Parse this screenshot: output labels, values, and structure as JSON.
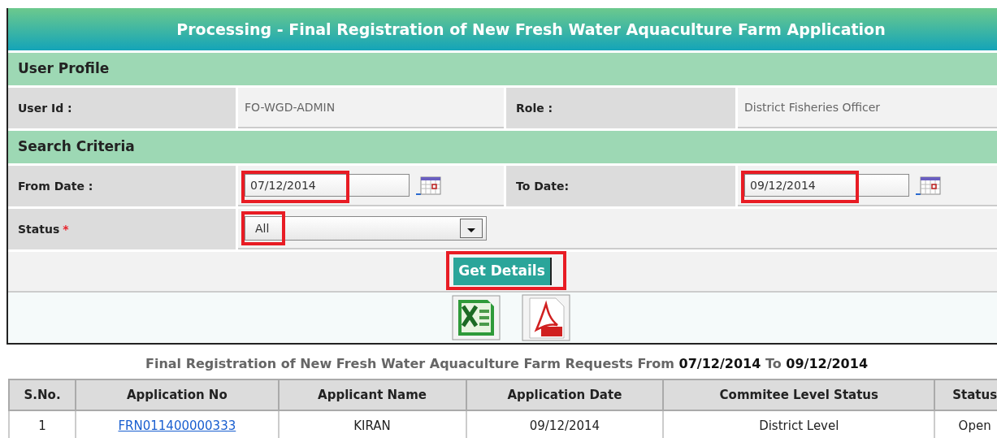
{
  "title": "Processing - Final Registration of New Fresh Water Aquaculture Farm Application",
  "user_profile": {
    "heading": "User Profile",
    "fields": [
      {
        "label": "User Id :",
        "value": "FO-WGD-ADMIN"
      },
      {
        "label": "Role :",
        "value": "District Fisheries Officer"
      }
    ]
  },
  "search_criteria": {
    "heading": "Search Criteria",
    "from_date": {
      "label": "From Date :",
      "value": "07/12/2014",
      "highlighted": true
    },
    "to_date": {
      "label": "To Date:",
      "value": "09/12/2014",
      "highlighted": true
    },
    "status": {
      "label": "Status",
      "required_mark": "*",
      "value": "All",
      "highlighted": true
    },
    "button": {
      "label": "Get Details",
      "highlighted": true
    }
  },
  "caption": {
    "text": "Final Registration of New Fresh Water Aquaculture Farm Requests From",
    "from": "07/12/2014",
    "to_word": "To",
    "to": "09/12/2014"
  },
  "table": {
    "columns": [
      "S.No.",
      "Application No",
      "Applicant Name",
      "Application Date",
      "Commitee Level Status",
      "Status"
    ],
    "rows": [
      [
        "1",
        "FRN011400000333",
        "KIRAN",
        "09/12/2014",
        "District Level",
        "Open"
      ]
    ]
  }
}
